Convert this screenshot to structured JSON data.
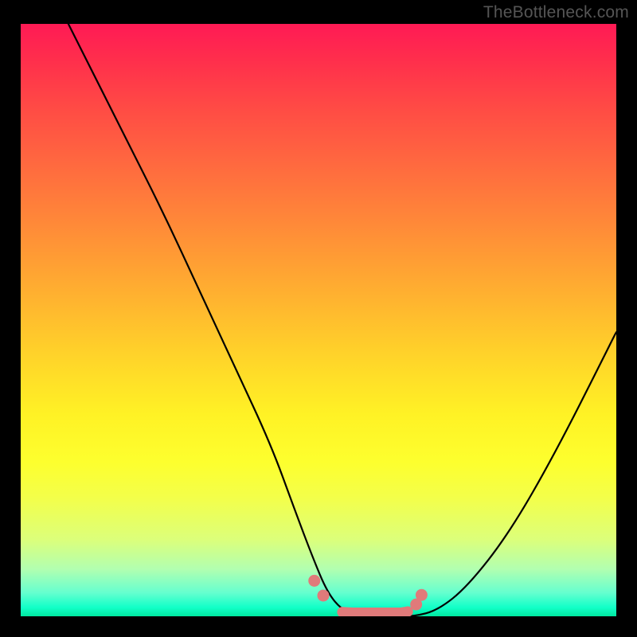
{
  "attribution": "TheBottleneck.com",
  "chart_data": {
    "type": "line",
    "title": "",
    "xlabel": "",
    "ylabel": "",
    "xlim": [
      0,
      100
    ],
    "ylim": [
      0,
      100
    ],
    "background_gradient_meaning": "red=high bottleneck, green=low bottleneck",
    "series": [
      {
        "name": "bottleneck-curve",
        "x": [
          8,
          13,
          18,
          24,
          30,
          36,
          42,
          46,
          49,
          51.5,
          54,
          57,
          60,
          63,
          66,
          70,
          75,
          82,
          90,
          100
        ],
        "values": [
          100,
          90,
          80,
          68,
          55,
          42,
          29,
          18,
          10,
          4,
          1,
          0,
          0,
          0,
          0,
          1,
          5,
          14,
          28,
          48
        ]
      }
    ],
    "valley_markers": {
      "name": "optimal-range-dots",
      "color": "#e07a7a",
      "x": [
        49.3,
        50.8,
        54.0,
        55.8,
        57.8,
        59.8,
        61.8,
        63.8,
        65.0,
        66.4,
        67.3
      ],
      "values": [
        6.0,
        3.5,
        0.7,
        0.6,
        0.6,
        0.6,
        0.6,
        0.6,
        0.8,
        2.0,
        3.6
      ]
    }
  }
}
